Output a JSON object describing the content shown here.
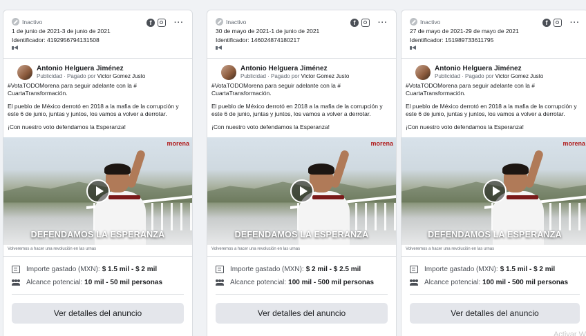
{
  "ads": [
    {
      "status": "Inactivo",
      "dates": "1 de junio de 2021-3 de junio de 2021",
      "id_label": "Identificador: 4192956794131508",
      "page_name": "Antonio Helguera Jiménez",
      "paid_by_prefix": "Publicidad · Pagado por",
      "paid_by_name": "Victor Gomez Justo",
      "text_1": "#VotaTODOMorena para seguir adelante con la # CuartaTransformación.",
      "text_2": "El pueblo de México derrotó en 2018 a la mafia de la corrupción y este 6 de junio, juntas y juntos, los vamos a volver a derrotar.",
      "text_3": "¡Con nuestro voto defendamos la Esperanza!",
      "media_brand": "morena",
      "media_slogan": "DEFENDAMOS LA ESPERANZA",
      "caption": "Volveremos a hacer una revolución en las urnas",
      "spend_label": "Importe gastado (MXN):",
      "spend_value": "$ 1.5 mil - $ 2 mil",
      "reach_label": "Alcance potencial:",
      "reach_value": "10 mil - 50 mil personas",
      "cta": "Ver detalles del anuncio"
    },
    {
      "status": "Inactivo",
      "dates": "30 de mayo de 2021-1 de junio de 2021",
      "id_label": "Identificador: 146024874180217",
      "page_name": "Antonio Helguera Jiménez",
      "paid_by_prefix": "Publicidad · Pagado por",
      "paid_by_name": "Victor Gomez Justo",
      "text_1": "#VotaTODOMorena para seguir adelante con la # CuartaTransformación.",
      "text_2": "El pueblo de México derrotó en 2018 a la mafia de la corrupción y este 6 de junio, juntas y juntos, los vamos a volver a derrotar.",
      "text_3": "¡Con nuestro voto defendamos la Esperanza!",
      "media_brand": "morena",
      "media_slogan": "DEFENDAMOS LA ESPERANZA",
      "caption": "Volveremos a hacer una revolución en las urnas",
      "spend_label": "Importe gastado (MXN):",
      "spend_value": "$ 2 mil - $ 2.5 mil",
      "reach_label": "Alcance potencial:",
      "reach_value": "100 mil - 500 mil personas",
      "cta": "Ver detalles del anuncio"
    },
    {
      "status": "Inactivo",
      "dates": "27 de mayo de 2021-29 de mayo de 2021",
      "id_label": "Identificador: 151989733611795",
      "page_name": "Antonio Helguera Jiménez",
      "paid_by_prefix": "Publicidad · Pagado por",
      "paid_by_name": "Victor Gomez Justo",
      "text_1": "#VotaTODOMorena para seguir adelante con la # CuartaTransformación.",
      "text_2": "El pueblo de México derrotó en 2018 a la mafia de la corrupción y este 6 de junio, juntas y juntos, los vamos a volver a derrotar.",
      "text_3": "¡Con nuestro voto defendamos la Esperanza!",
      "media_brand": "morena",
      "media_slogan": "DEFENDAMOS LA ESPERANZA",
      "caption": "Volveremos a hacer una revolución en las urnas",
      "spend_label": "Importe gastado (MXN):",
      "spend_value": "$ 1.5 mil - $ 2 mil",
      "reach_label": "Alcance potencial:",
      "reach_value": "100 mil - 500 mil personas",
      "cta": "Ver detalles del anuncio"
    }
  ],
  "icons": {
    "status": "inactive-status-icon",
    "facebook": "facebook-icon",
    "instagram": "instagram-icon",
    "more": "more-options-icon",
    "media_type": "megaphone-icon",
    "spend": "receipt-icon",
    "reach": "people-icon"
  },
  "watermark": "Activar W"
}
